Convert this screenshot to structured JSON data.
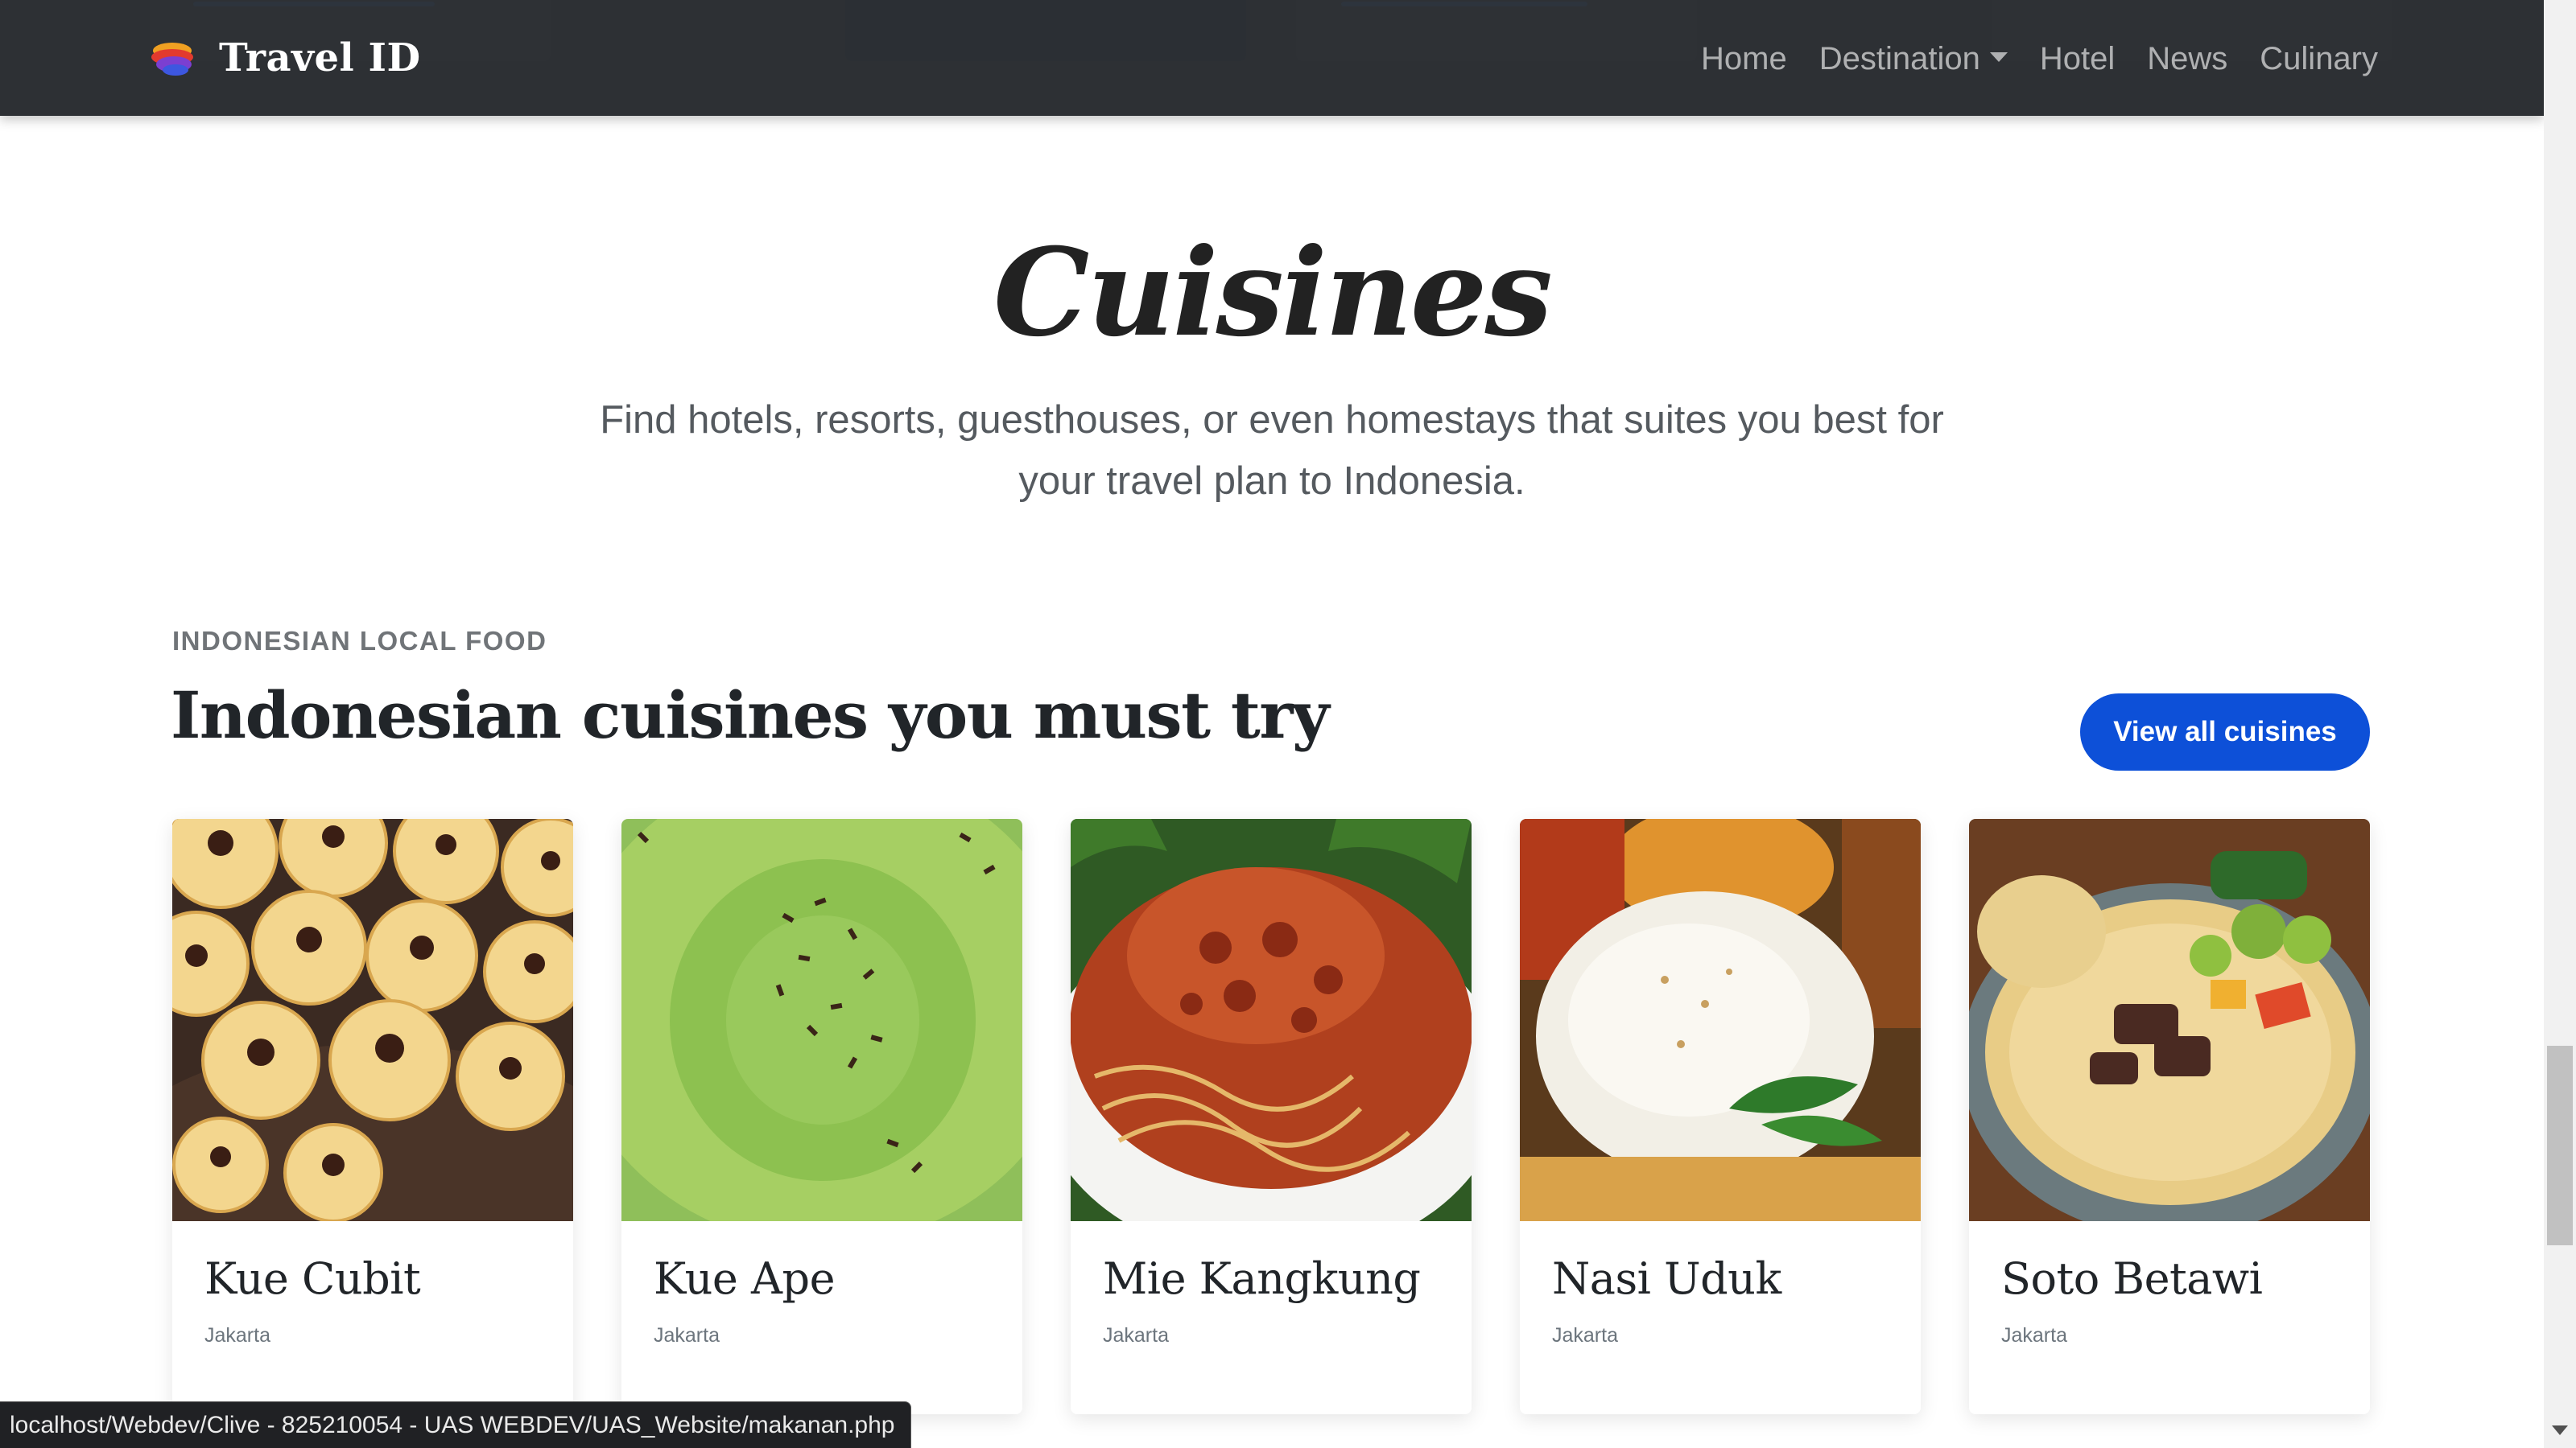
{
  "navbar": {
    "brand": "Travel ID",
    "links": {
      "home": "Home",
      "destination": "Destination",
      "hotel": "Hotel",
      "news": "News",
      "culinary": "Culinary"
    }
  },
  "hero": {
    "title": "Cuisines",
    "subtitle": "Find hotels, resorts, guesthouses, or even homestays that suites you best for your travel plan to Indonesia."
  },
  "section": {
    "eyebrow": "INDONESIAN LOCAL FOOD",
    "title": "Indonesian cuisines you must try",
    "button_label": "View all cuisines"
  },
  "cards": [
    {
      "name": "Kue Cubit",
      "location": "Jakarta"
    },
    {
      "name": "Kue Ape",
      "location": "Jakarta"
    },
    {
      "name": "Mie Kangkung",
      "location": "Jakarta"
    },
    {
      "name": "Nasi Uduk",
      "location": "Jakarta"
    },
    {
      "name": "Soto Betawi",
      "location": "Jakarta"
    }
  ],
  "status_bar": {
    "url": "localhost/Webdev/Clive - 825210054 - UAS WEBDEV/UAS_Website/makanan.php"
  },
  "colors": {
    "navbar_bg": "#2c2f34",
    "primary_button": "#0d50d8",
    "heading": "#212529",
    "muted": "#6c757d"
  }
}
